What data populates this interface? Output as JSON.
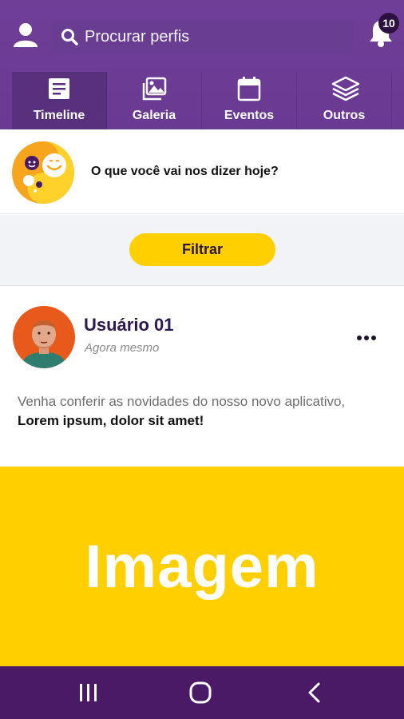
{
  "header": {
    "search": {
      "placeholder": "Procurar perfis"
    },
    "notifications": {
      "count": "10"
    },
    "icons": {
      "user": "user-icon",
      "search": "search-icon",
      "bell": "bell-icon"
    }
  },
  "tabs": [
    {
      "label": "Timeline",
      "icon": "document-icon",
      "active": true
    },
    {
      "label": "Galeria",
      "icon": "gallery-icon",
      "active": false
    },
    {
      "label": "Eventos",
      "icon": "calendar-icon",
      "active": false
    },
    {
      "label": "Outros",
      "icon": "layers-icon",
      "active": false
    }
  ],
  "composer": {
    "prompt": "O que você vai nos dizer hoje?"
  },
  "filter": {
    "label": "Filtrar"
  },
  "post": {
    "author": "Usuário 01",
    "time": "Agora mesmo",
    "body_text": "Venha conferir as novidades do nosso novo aplicativo,",
    "body_bold": "Lorem ipsum, dolor sit amet!",
    "image_label": "Imagem"
  },
  "navbar": {
    "icons": [
      "recents-icon",
      "home-icon",
      "back-icon"
    ]
  },
  "colors": {
    "header": "#6f3f98",
    "accent": "#ffcf00",
    "navbar": "#4a1a66",
    "author": "#2d1b4e"
  }
}
